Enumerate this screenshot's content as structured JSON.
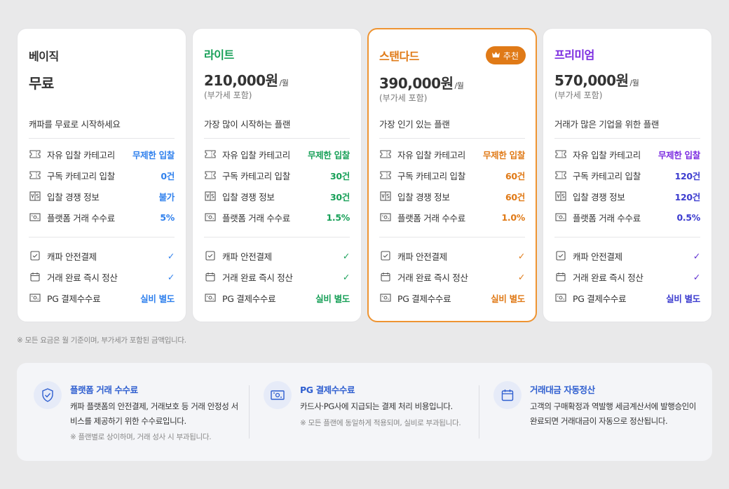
{
  "colors": {
    "basic": "#333333",
    "basic_value": "#2f80ed",
    "lite": "#18a058",
    "standard": "#e07a17",
    "premium": "#7b2be0",
    "premium_value": "#3c3ccf"
  },
  "plans": [
    {
      "name": "베이직",
      "price": "무료",
      "per": "",
      "vat": "",
      "desc": "캐파를 무료로 시작하세요",
      "features": [
        {
          "icon": "ticket-icon",
          "label": "자유 입찰 카테고리",
          "value": "무제한 입찰"
        },
        {
          "icon": "ticket-icon",
          "label": "구독 카테고리 입찰",
          "value": "0건"
        },
        {
          "icon": "versus-icon",
          "label": "입찰 경쟁 정보",
          "value": "불가"
        },
        {
          "icon": "money-icon",
          "label": "플랫폼 거래 수수료",
          "value": "5%"
        }
      ],
      "services": [
        {
          "icon": "checkbox-icon",
          "label": "캐파 안전결제",
          "value": "✓"
        },
        {
          "icon": "calendar-icon",
          "label": "거래 완료 즉시 정산",
          "value": "✓"
        },
        {
          "icon": "money-icon",
          "label": "PG 결제수수료",
          "value": "실비 별도"
        }
      ]
    },
    {
      "name": "라이트",
      "price": "210,000원",
      "per": "/월",
      "vat": "(부가세 포함)",
      "desc": "가장 많이 시작하는 플랜",
      "features": [
        {
          "icon": "ticket-icon",
          "label": "자유 입찰 카테고리",
          "value": "무제한 입찰"
        },
        {
          "icon": "ticket-icon",
          "label": "구독 카테고리 입찰",
          "value": "30건"
        },
        {
          "icon": "versus-icon",
          "label": "입찰 경쟁 정보",
          "value": "30건"
        },
        {
          "icon": "money-icon",
          "label": "플랫폼 거래 수수료",
          "value": "1.5%"
        }
      ],
      "services": [
        {
          "icon": "checkbox-icon",
          "label": "캐파 안전결제",
          "value": "✓"
        },
        {
          "icon": "calendar-icon",
          "label": "거래 완료 즉시 정산",
          "value": "✓"
        },
        {
          "icon": "money-icon",
          "label": "PG 결제수수료",
          "value": "실비 별도"
        }
      ]
    },
    {
      "name": "스탠다드",
      "badge": "추천",
      "price": "390,000원",
      "per": "/월",
      "vat": "(부가세 포함)",
      "desc": "가장 인기 있는 플랜",
      "features": [
        {
          "icon": "ticket-icon",
          "label": "자유 입찰 카테고리",
          "value": "무제한 입찰"
        },
        {
          "icon": "ticket-icon",
          "label": "구독 카테고리 입찰",
          "value": "60건"
        },
        {
          "icon": "versus-icon",
          "label": "입찰 경쟁 정보",
          "value": "60건"
        },
        {
          "icon": "money-icon",
          "label": "플랫폼 거래 수수료",
          "value": "1.0%"
        }
      ],
      "services": [
        {
          "icon": "checkbox-icon",
          "label": "캐파 안전결제",
          "value": "✓"
        },
        {
          "icon": "calendar-icon",
          "label": "거래 완료 즉시 정산",
          "value": "✓"
        },
        {
          "icon": "money-icon",
          "label": "PG 결제수수료",
          "value": "실비 별도"
        }
      ]
    },
    {
      "name": "프리미엄",
      "price": "570,000원",
      "per": "/월",
      "vat": "(부가세 포함)",
      "desc": "거래가 많은 기업을 위한 플랜",
      "features": [
        {
          "icon": "ticket-icon",
          "label": "자유 입찰 카테고리",
          "value": "무제한 입찰"
        },
        {
          "icon": "ticket-icon",
          "label": "구독 카테고리 입찰",
          "value": "120건"
        },
        {
          "icon": "versus-icon",
          "label": "입찰 경쟁 정보",
          "value": "120건"
        },
        {
          "icon": "money-icon",
          "label": "플랫폼 거래 수수료",
          "value": "0.5%"
        }
      ],
      "services": [
        {
          "icon": "checkbox-icon",
          "label": "캐파 안전결제",
          "value": "✓"
        },
        {
          "icon": "calendar-icon",
          "label": "거래 완료 즉시 정산",
          "value": "✓"
        },
        {
          "icon": "money-icon",
          "label": "PG 결제수수료",
          "value": "실비 별도"
        }
      ]
    }
  ],
  "note": "※ 모든 요금은 월 기준이며, 부가세가 포함된 금액입니다.",
  "info": [
    {
      "icon": "shield-check-icon",
      "title": "플랫폼 거래 수수료",
      "text": "캐파 플랫폼의 안전결제, 거래보호 등 거래 안정성 서비스를 제공하기 위한 수수료입니다.",
      "note": "※ 플랜별로 상이하며, 거래 성사 시 부과됩니다."
    },
    {
      "icon": "money-icon",
      "title": "PG 결제수수료",
      "text": "카드사·PG사에 지급되는 결제 처리 비용입니다.",
      "note": "※ 모든 플랜에 동일하게 적용되며, 실비로 부과됩니다."
    },
    {
      "icon": "calendar-icon",
      "title": "거래대금 자동정산",
      "text": "고객의 구매확정과 역발행 세금계산서에 발행승인이 완료되면 거래대금이 자동으로 정산됩니다.",
      "note": ""
    }
  ]
}
